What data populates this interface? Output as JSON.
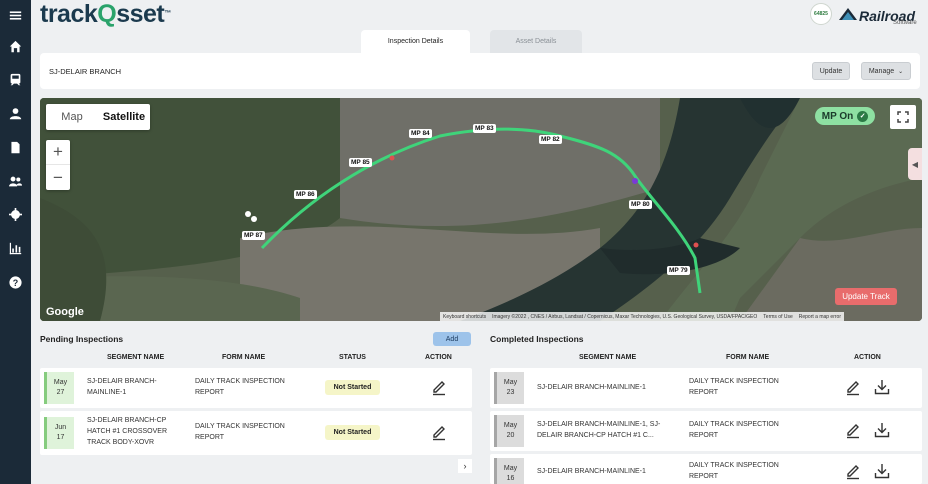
{
  "app": {
    "logo_left": "track",
    "logo_q": "Q",
    "logo_right": "sset",
    "logo_tm": "™",
    "badge_text": "64825",
    "brand_name": "Railroad",
    "brand_sub": "Software"
  },
  "tabs": [
    {
      "label": "Inspection Details",
      "active": true
    },
    {
      "label": "Asset Details",
      "active": false
    }
  ],
  "titlebar": {
    "title": "SJ-DELAIR BRANCH",
    "update_label": "Update",
    "manage_label": "Manage"
  },
  "map": {
    "type_map": "Map",
    "type_satellite": "Satellite",
    "zoom_in": "+",
    "zoom_out": "−",
    "mp_toggle": "MP On",
    "update_track": "Update Track",
    "google": "Google",
    "attribution": [
      "Keyboard shortcuts",
      "Imagery ©2022 , CNES / Airbus, Landsat / Copernicus, Maxar Technologies, U.S. Geological Survey, USDA/FPAC/GEO",
      "Terms of Use",
      "Report a map error"
    ],
    "mileposts": [
      "MP 87",
      "MP 86",
      "MP 85",
      "MP 84",
      "MP 83",
      "MP 82",
      "MP 80",
      "MP 79"
    ]
  },
  "pending": {
    "title": "Pending Inspections",
    "add_label": "Add",
    "headers": [
      "SEGMENT NAME",
      "FORM NAME",
      "STATUS",
      "ACTION"
    ],
    "rows": [
      {
        "month": "May",
        "day": "27",
        "segment": "SJ-DELAIR BRANCH-MAINLINE-1",
        "form": "DAILY TRACK INSPECTION REPORT",
        "status": "Not Started"
      },
      {
        "month": "Jun",
        "day": "17",
        "segment": "SJ-DELAIR BRANCH-CP HATCH #1 CROSSOVER TRACK BODY-XOVR",
        "form": "DAILY TRACK INSPECTION REPORT",
        "status": "Not Started"
      }
    ],
    "pager": "›"
  },
  "completed": {
    "title": "Completed Inspections",
    "headers": [
      "SEGMENT NAME",
      "FORM NAME",
      "ACTION"
    ],
    "rows": [
      {
        "month": "May",
        "day": "23",
        "segment": "SJ-DELAIR BRANCH-MAINLINE-1",
        "form": "DAILY TRACK INSPECTION REPORT"
      },
      {
        "month": "May",
        "day": "20",
        "segment": "SJ-DELAIR BRANCH-MAINLINE-1, SJ-DELAIR BRANCH-CP HATCH #1 C...",
        "form": "DAILY TRACK INSPECTION REPORT"
      },
      {
        "month": "May",
        "day": "16",
        "segment": "SJ-DELAIR BRANCH-MAINLINE-1",
        "form": "DAILY TRACK INSPECTION REPORT"
      }
    ]
  },
  "colors": {
    "sidebar": "#1b2a38",
    "accent_green": "#2aa36b",
    "track_line": "#3fd47a",
    "update_track": "#e86c6c"
  }
}
